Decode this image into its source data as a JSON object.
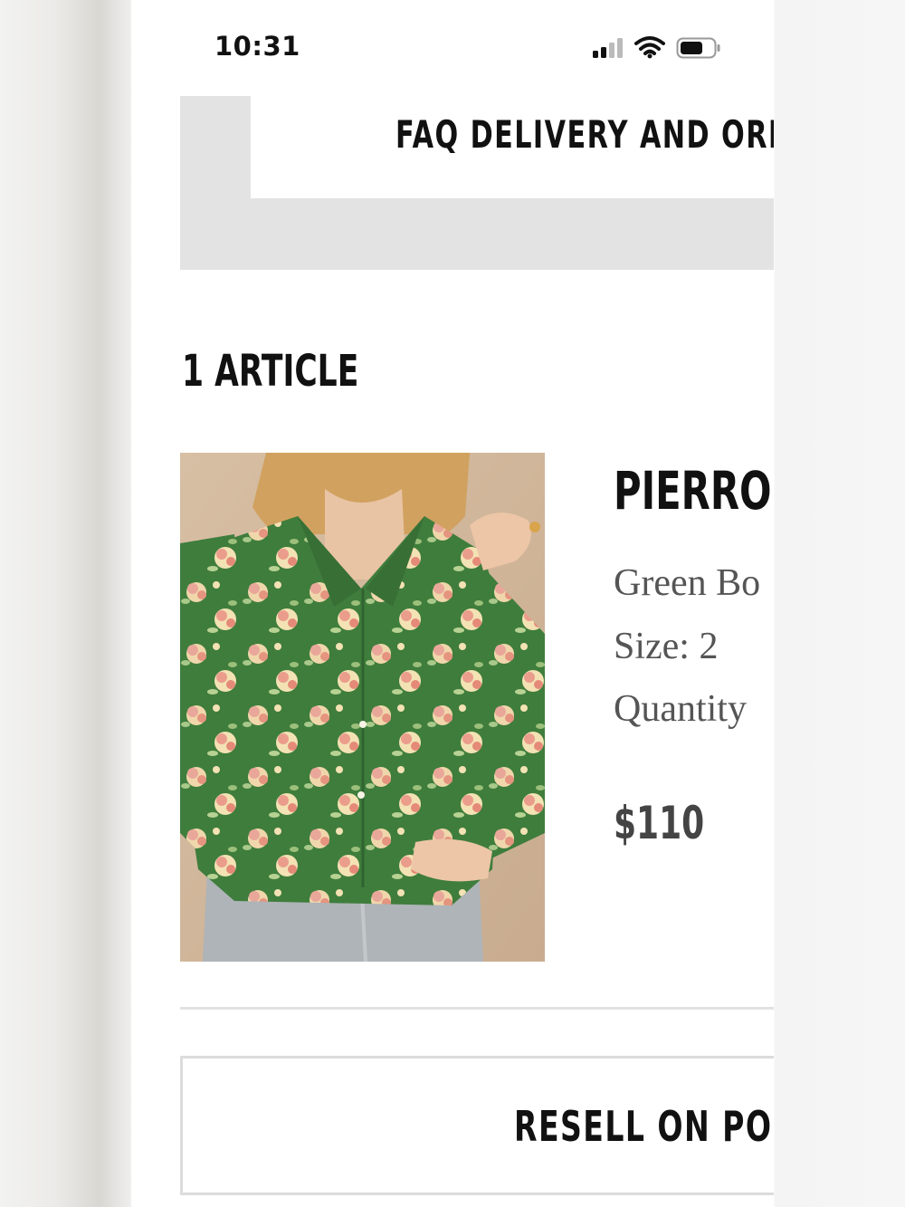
{
  "status_bar": {
    "time": "10:31",
    "signal_icon": "cellular-signal-icon",
    "wifi_icon": "wifi-icon",
    "battery_icon": "battery-icon"
  },
  "faq": {
    "title": "FAQ DELIVERY AND ORD"
  },
  "cart": {
    "article_count": "1 ARTICLE",
    "item": {
      "name": "PIERRO",
      "color": "Green Bo",
      "size": "Size: 2",
      "quantity": "Quantity",
      "price": "$110",
      "image_description_icon": "floral-shirt-image"
    }
  },
  "actions": {
    "resell_label": "RESELL ON POSH"
  },
  "colors": {
    "faq_bg": "#e3e3e3",
    "text_dark": "#111111",
    "text_muted": "#555555",
    "shirt_green": "#3f7d3c",
    "flower_pink": "#e9a79a",
    "flower_cream": "#f3e2b4"
  }
}
